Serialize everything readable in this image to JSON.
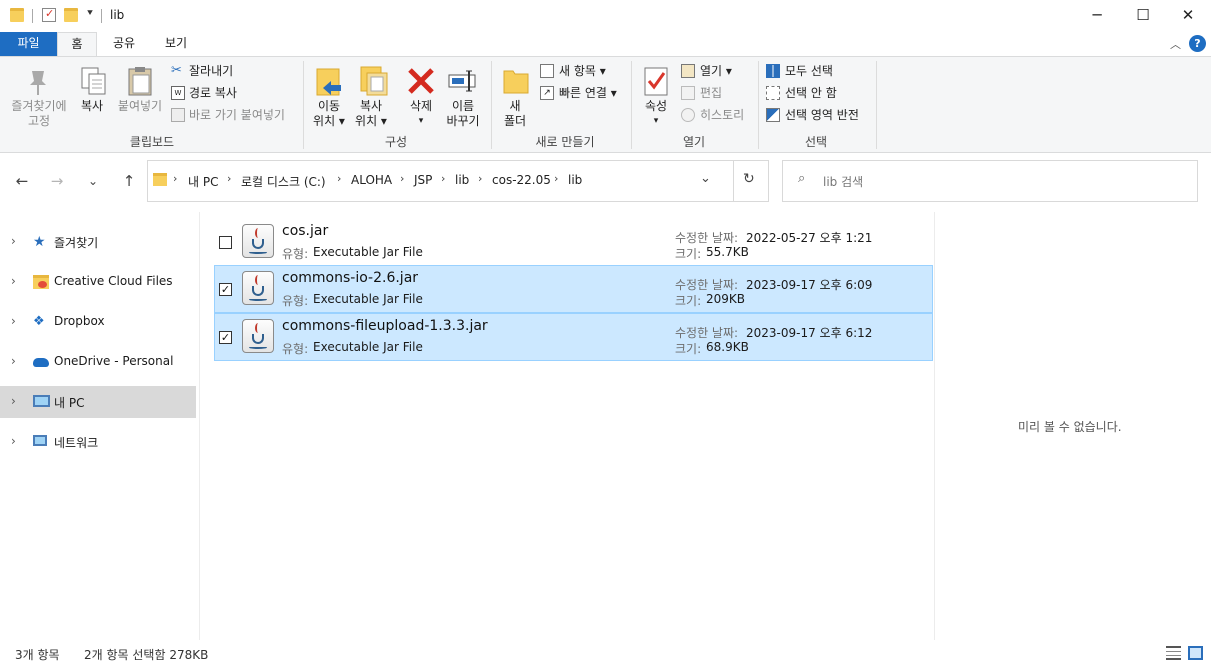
{
  "window": {
    "title": "lib",
    "minimize_glyph": "─",
    "maximize_glyph": "☐",
    "close_glyph": "✕"
  },
  "ribbon_tabs": [
    "파일",
    "홈",
    "공유",
    "보기"
  ],
  "ribbon": {
    "clipboard": {
      "pin_label_1": "즐겨찾기에",
      "pin_label_2": "고정",
      "copy_label": "복사",
      "paste_label": "붙여넣기",
      "cut_label": "잘라내기",
      "copy_path_label": "경로 복사",
      "paste_shortcut_label": "바로 가기 붙여넣기",
      "group_label": "클립보드"
    },
    "organize": {
      "move_label_1": "이동",
      "move_label_2": "위치 ▾",
      "copyto_label_1": "복사",
      "copyto_label_2": "위치 ▾",
      "delete_label_1": "삭제",
      "delete_label_2": "▾",
      "rename_label_1": "이름",
      "rename_label_2": "바꾸기",
      "group_label": "구성"
    },
    "new": {
      "new_folder_label_1": "새",
      "new_folder_label_2": "폴더",
      "new_item_label": "새 항목 ▾",
      "easy_access_label": "빠른 연결 ▾",
      "group_label": "새로 만들기"
    },
    "open": {
      "properties_label_1": "속성",
      "properties_label_2": "▾",
      "open_label": "열기 ▾",
      "edit_label": "편집",
      "history_label": "히스토리",
      "group_label": "열기"
    },
    "select": {
      "select_all_label": "모두 선택",
      "select_none_label": "선택 안 함",
      "invert_label": "선택 영역 반전",
      "group_label": "선택"
    }
  },
  "address": {
    "back_glyph": "←",
    "forward_glyph": "→",
    "recent_glyph": "⌄",
    "up_glyph": "↑",
    "crumbs": [
      "내 PC",
      "로컬 디스크 (C:)",
      "ALOHA",
      "JSP",
      "lib",
      "cos-22.05",
      "lib"
    ],
    "crumb_sep": "›",
    "dropdown_glyph": "⌄",
    "refresh_glyph": "↻",
    "search_placeholder": "lib 검색"
  },
  "nav_pane": [
    {
      "label": "즐겨찾기",
      "icon": "star-icon"
    },
    {
      "label": "Creative Cloud Files",
      "icon": "creative-cloud-folder-icon"
    },
    {
      "label": "Dropbox",
      "icon": "dropbox-icon"
    },
    {
      "label": "OneDrive - Personal",
      "icon": "onedrive-icon"
    },
    {
      "label": "내 PC",
      "icon": "computer-icon"
    },
    {
      "label": "네트워크",
      "icon": "network-icon"
    }
  ],
  "files": [
    {
      "name": "cos.jar",
      "type_label": "유형:",
      "type": "Executable Jar File",
      "date_label": "수정한 날짜:",
      "date": "2022-05-27 오후 1:21",
      "size_label": "크기:",
      "size": "55.7KB",
      "selected": false
    },
    {
      "name": "commons-io-2.6.jar",
      "type_label": "유형:",
      "type": "Executable Jar File",
      "date_label": "수정한 날짜:",
      "date": "2023-09-17 오후 6:09",
      "size_label": "크기:",
      "size": "209KB",
      "selected": true
    },
    {
      "name": "commons-fileupload-1.3.3.jar",
      "type_label": "유형:",
      "type": "Executable Jar File",
      "date_label": "수정한 날짜:",
      "date": "2023-09-17 오후 6:12",
      "size_label": "크기:",
      "size": "68.9KB",
      "selected": true
    }
  ],
  "check_glyph": "✓",
  "preview": {
    "message": "미리 볼 수 없습니다."
  },
  "status": {
    "item_count": "3개 항목",
    "selection": "2개 항목 선택함 278KB"
  },
  "colors": {
    "accent": "#1e6dc2",
    "selection_bg": "#cce8ff",
    "selection_border": "#99d1ff",
    "nav_selected": "#d9d9d9"
  }
}
